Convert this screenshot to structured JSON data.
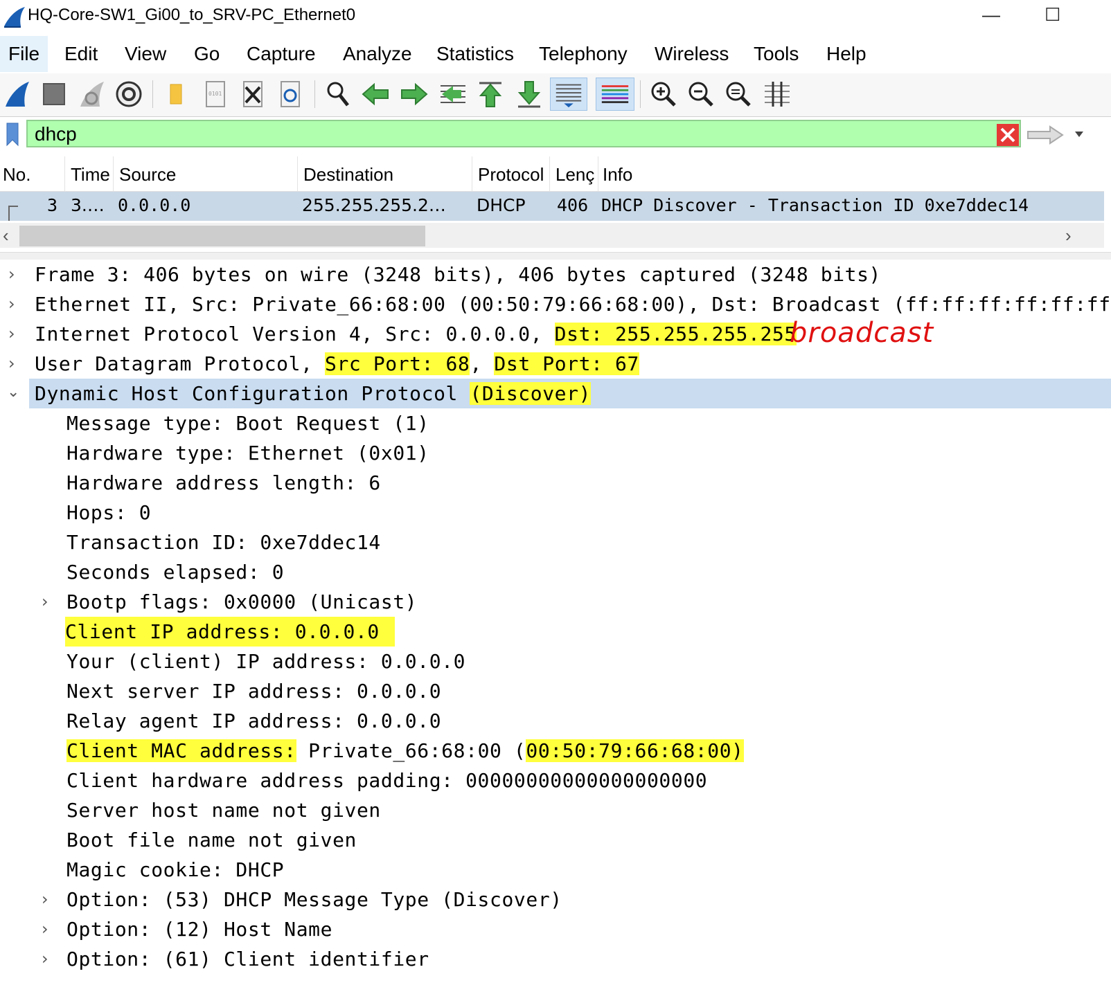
{
  "window": {
    "title": "HQ-Core-SW1_Gi00_to_SRV-PC_Ethernet0",
    "minimize_glyph": "—",
    "maximize_glyph": "☐"
  },
  "menu": [
    "File",
    "Edit",
    "View",
    "Go",
    "Capture",
    "Analyze",
    "Statistics",
    "Telephony",
    "Wireless",
    "Tools",
    "Help"
  ],
  "toolbar_icons": [
    "start-capture",
    "stop-capture",
    "restart-capture",
    "capture-options",
    "open-file",
    "save-file",
    "close-file",
    "reload-file",
    "find-packet",
    "go-back",
    "go-forward",
    "go-to-packet",
    "go-first",
    "go-last",
    "autoscroll",
    "colorize",
    "zoom-in",
    "zoom-out",
    "zoom-normal",
    "resize-columns"
  ],
  "filter": {
    "value": "dhcp"
  },
  "packet_list": {
    "columns": [
      "No.",
      "Time",
      "Source",
      "Destination",
      "Protocol",
      "Length",
      "Info"
    ],
    "column_labels_shown": [
      "No.",
      "Time",
      "Source",
      "Destination",
      "Protocol",
      "Lenç",
      "Info"
    ],
    "rows": [
      {
        "no": "3",
        "time": "3.…",
        "source": "0.0.0.0",
        "destination": "255.255.255.2…",
        "protocol": "DHCP",
        "length": "406",
        "info": "DHCP Discover - Transaction ID 0xe7ddec14"
      }
    ]
  },
  "details": {
    "frame": "Frame 3: 406 bytes on wire (3248 bits), 406 bytes captured (3248 bits)",
    "ethernet": "Ethernet II, Src: Private_66:68:00 (00:50:79:66:68:00), Dst: Broadcast (ff:ff:ff:ff:ff:ff",
    "ip_prefix": "Internet Protocol Version 4, Src: 0.0.0.0, ",
    "ip_dst": "Dst: 255.255.255.255",
    "udp_prefix": "User Datagram Protocol, ",
    "udp_src": "Src Port: 68",
    "udp_sep": ", ",
    "udp_dst": "Dst Port: 67",
    "dhcp_prefix": "Dynamic Host Configuration Protocol ",
    "dhcp_type": "(Discover)",
    "fields": {
      "message_type": "Message type: Boot Request (1)",
      "hardware_type": "Hardware type: Ethernet (0x01)",
      "hw_addr_len": "Hardware address length: 6",
      "hops": "Hops: 0",
      "transaction_id": "Transaction ID: 0xe7ddec14",
      "seconds": "Seconds elapsed: 0",
      "bootp_flags": "Bootp flags: 0x0000 (Unicast)",
      "client_ip": "Client IP address: 0.0.0.0",
      "your_ip": "Your (client) IP address: 0.0.0.0",
      "next_server": "Next server IP address: 0.0.0.0",
      "relay_agent": "Relay agent IP address: 0.0.0.0",
      "client_mac_label": "Client MAC address:",
      "client_mac_mid": " Private_66:68:00 (",
      "client_mac_value": "00:50:79:66:68:00)",
      "padding": "Client hardware address padding: 00000000000000000000",
      "server_host": "Server host name not given",
      "boot_file": "Boot file name not given",
      "magic_cookie": "Magic cookie: DHCP",
      "option53": "Option: (53) DHCP Message Type (Discover)",
      "option12": "Option: (12) Host Name",
      "option61": "Option: (61) Client identifier"
    }
  },
  "annotation": {
    "text": "broadcast",
    "color": "#e01010"
  },
  "colors": {
    "highlight": "#ffff3d",
    "filter_valid": "#afffaf",
    "selected_row": "#c9d8e6",
    "selected_tree": "#c9dcf0"
  }
}
